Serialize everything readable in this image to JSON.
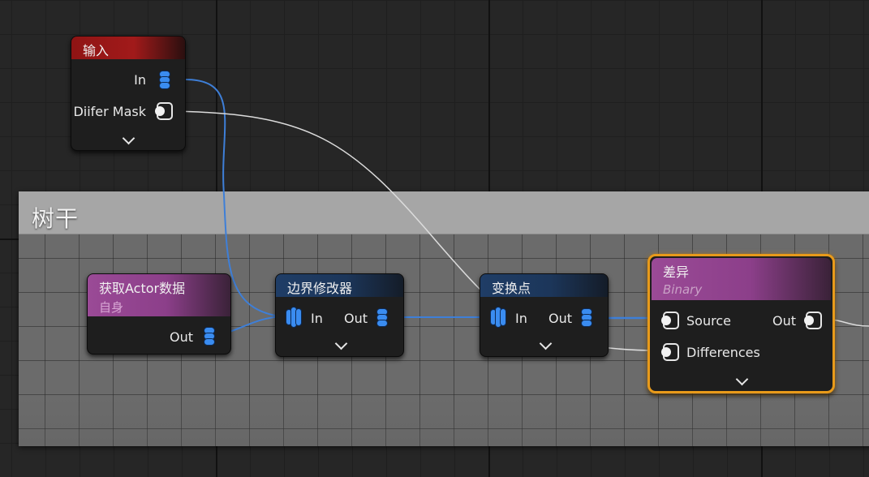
{
  "comment": {
    "title": "树干"
  },
  "nodes": {
    "input": {
      "title": "输入",
      "pins": {
        "in": "In",
        "mask": "Diifer Mask"
      }
    },
    "get_actor": {
      "title": "获取Actor数据",
      "subtitle": "自身",
      "pins": {
        "out": "Out"
      }
    },
    "bounds": {
      "title": "边界修改器",
      "pins": {
        "in": "In",
        "out": "Out"
      }
    },
    "transform": {
      "title": "变换点",
      "pins": {
        "in": "In",
        "out": "Out"
      }
    },
    "difference": {
      "title": "差异",
      "subtitle": "Binary",
      "pins": {
        "source": "Source",
        "out": "Out",
        "differences": "Differences"
      }
    }
  },
  "colors": {
    "point_data_pin": "#3a8cf0",
    "wire_point": "#3e7fd8",
    "wire_spatial": "#dcdcdc",
    "selected_outline": "#e89a1a",
    "header_input": "#a11a1a",
    "header_data": "#9a4a96",
    "header_op": "#1f3d66"
  }
}
